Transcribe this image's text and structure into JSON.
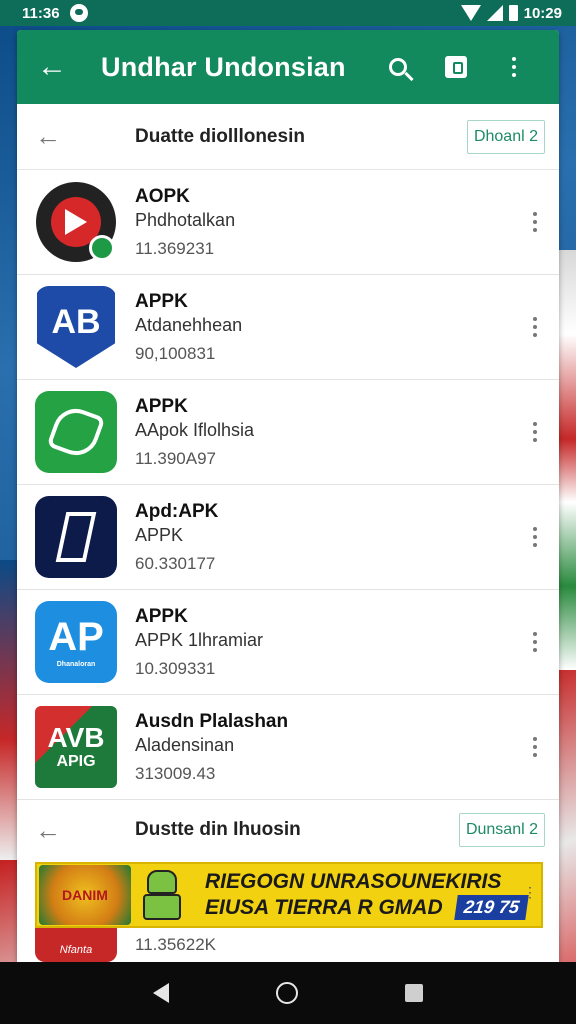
{
  "status_bar": {
    "time_left": "11:36",
    "time_right": "10:29"
  },
  "app_bar": {
    "title": "Undhar Undonsian",
    "icons": [
      "back-arrow-icon",
      "search-icon",
      "bag-icon",
      "more-vert-icon"
    ]
  },
  "section1": {
    "title": "Duatte diolllonesin",
    "button_label": "Dhoanl 2"
  },
  "apps": [
    {
      "name": "AOPK",
      "subtitle": "Phdhotalkan",
      "number": "11.369231",
      "icon": "red-play-icon"
    },
    {
      "name": "APPK",
      "subtitle": "Atdanehhean",
      "number": "90,100831",
      "icon": "ab-shield-icon"
    },
    {
      "name": "APPK",
      "subtitle": "AApok Iflolhsia",
      "number": "11.390A97",
      "icon": "green-leaf-icon"
    },
    {
      "name": "Apd:APK",
      "subtitle": "APPK",
      "number": "60.330177",
      "icon": "navy-phone-icon"
    },
    {
      "name": "APPK",
      "subtitle": "APPK 1lhramiar",
      "number": "10.309331",
      "icon": "ap-blue-icon"
    },
    {
      "name": "Ausdn Plalashan",
      "subtitle": "Aladensinan",
      "number": "313009.43",
      "icon": "avb-apig-icon"
    }
  ],
  "app_icon_text": {
    "ab": "AB",
    "ap_big": "AP",
    "ap_small": "Dhanaloran",
    "avb_big": "AVB",
    "avb_small": "APIG"
  },
  "section2": {
    "title": "Dustte din Ihuosin",
    "button_label": "Dunsanl 2"
  },
  "ad": {
    "logo_text": "DANIM",
    "line1": "RIEGOGN UNRASOUNEKIRIS",
    "line2": "EIUSA TIERRA R GMAD",
    "price": "219 75"
  },
  "partial_row": {
    "icon_text": "Nfanta",
    "number": "11.35622K"
  },
  "colors": {
    "app_bar": "#138a5e",
    "status_bar": "#0e6d58",
    "ad_yellow": "#f2d210",
    "section_button_text": "#1f8a68"
  }
}
